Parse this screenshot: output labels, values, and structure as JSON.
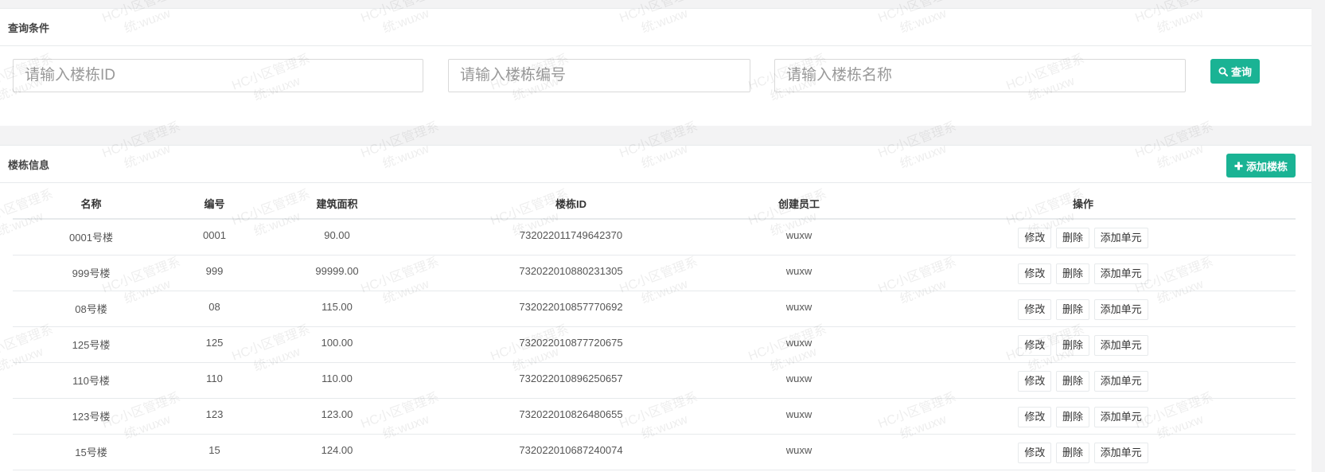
{
  "query": {
    "title": "查询条件",
    "placeholder_id": "请输入楼栋ID",
    "placeholder_num": "请输入楼栋编号",
    "placeholder_name": "请输入楼栋名称",
    "search_label": "查询"
  },
  "list": {
    "title": "楼栋信息",
    "add_label": "添加楼栋",
    "columns": [
      "名称",
      "编号",
      "建筑面积",
      "楼栋ID",
      "创建员工",
      "操作"
    ],
    "rows": [
      {
        "name": "0001号楼",
        "num": "0001",
        "area": "90.00",
        "id": "732022011749642370",
        "staff": "wuxw"
      },
      {
        "name": "999号楼",
        "num": "999",
        "area": "99999.00",
        "id": "732022010880231305",
        "staff": "wuxw"
      },
      {
        "name": "08号楼",
        "num": "08",
        "area": "115.00",
        "id": "732022010857770692",
        "staff": "wuxw"
      },
      {
        "name": "125号楼",
        "num": "125",
        "area": "100.00",
        "id": "732022010877720675",
        "staff": "wuxw"
      },
      {
        "name": "110号楼",
        "num": "110",
        "area": "110.00",
        "id": "732022010896250657",
        "staff": "wuxw"
      },
      {
        "name": "123号楼",
        "num": "123",
        "area": "123.00",
        "id": "732022010826480655",
        "staff": "wuxw"
      },
      {
        "name": "15号楼",
        "num": "15",
        "area": "124.00",
        "id": "732022010687240074",
        "staff": "wuxw"
      }
    ],
    "ops": {
      "edit": "修改",
      "delete": "删除",
      "add_unit": "添加单元"
    }
  },
  "watermark": {
    "line1": "HC小区管理系",
    "line2": "统:wuxw"
  },
  "icons": {
    "search": "search-icon",
    "add": "plus-icon"
  },
  "colors": {
    "primary": "#1ab394"
  }
}
